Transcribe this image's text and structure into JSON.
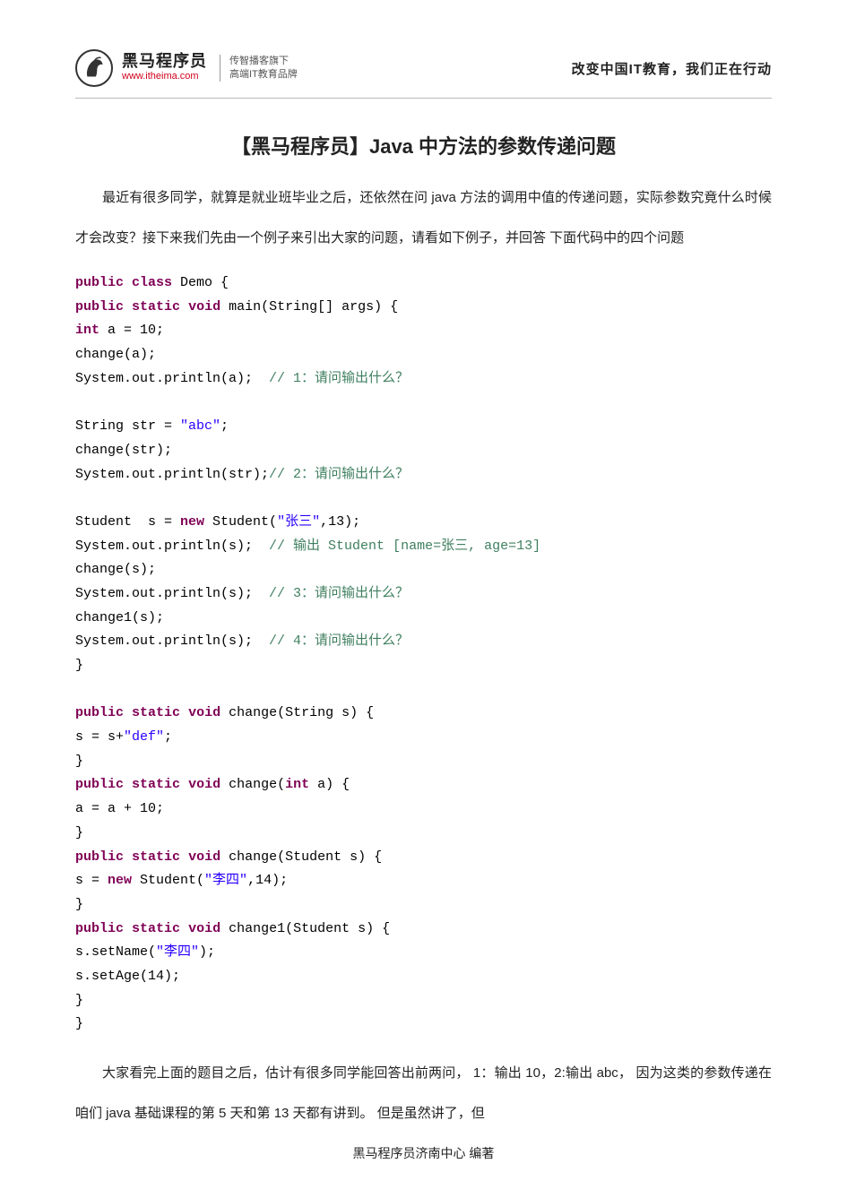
{
  "header": {
    "logo_cn": "黑马程序员",
    "logo_en": "www.itheima.com",
    "logo_side_line1": "传智播客旗下",
    "logo_side_line2": "高端IT教育品牌",
    "slogan": "改变中国IT教育，我们正在行动"
  },
  "title": "【黑马程序员】Java 中方法的参数传递问题",
  "intro": "最近有很多同学，就算是就业班毕业之后，还依然在问 java 方法的调用中值的传递问题，实际参数究竟什么时候才会改变？接下来我们先由一个例子来引出大家的问题，请看如下例子，并回答 下面代码中的四个问题",
  "code": {
    "l1a": "public",
    "l1b": "class",
    "l1c": " Demo {",
    "l2a": "public",
    "l2b": "static",
    "l2c": "void",
    "l2d": " main(String[] args) {",
    "l3a": "int",
    "l3b": " a = 10;",
    "l4": "change(a);",
    "l5a": "System.out.println(a);  ",
    "l5b": "// 1：请问输出什么？",
    "l6a": "String str = ",
    "l6b": "\"abc\"",
    "l6c": ";",
    "l7": "change(str);",
    "l8a": "System.out.println(str);",
    "l8b": "// 2：请问输出什么？",
    "l9a": "Student  s = ",
    "l9b": "new",
    "l9c": " Student(",
    "l9d": "\"张三\"",
    "l9e": ",13);",
    "l10a": "System.out.println(s);  ",
    "l10b": "// 输出 Student [name=张三, age=13]",
    "l11": "change(s);",
    "l12a": "System.out.println(s);  ",
    "l12b": "// 3：请问输出什么？",
    "l13": "change1(s);",
    "l14a": "System.out.println(s);  ",
    "l14b": "// 4：请问输出什么？",
    "l15": "}",
    "l16a": "public",
    "l16b": "static",
    "l16c": "void",
    "l16d": " change(String s) {",
    "l17a": "s = s+",
    "l17b": "\"def\"",
    "l17c": ";",
    "l18": "}",
    "l19a": "public",
    "l19b": "static",
    "l19c": "void",
    "l19d": " change(",
    "l19e": "int",
    "l19f": " a) {",
    "l20": "a = a + 10;",
    "l21": "}",
    "l22a": "public",
    "l22b": "static",
    "l22c": "void",
    "l22d": " change(Student s) {",
    "l23a": "s = ",
    "l23b": "new",
    "l23c": " Student(",
    "l23d": "\"李四\"",
    "l23e": ",14);",
    "l24": "}",
    "l25a": "public",
    "l25b": "static",
    "l25c": "void",
    "l25d": " change1(Student s) {",
    "l26a": "s.setName(",
    "l26b": "\"李四\"",
    "l26c": ");",
    "l27": "s.setAge(14);",
    "l28": "}",
    "l29": "}"
  },
  "outro": "大家看完上面的题目之后，估计有很多同学能回答出前两问， 1：输出 10，2:输出 abc， 因为这类的参数传递在咱们 java 基础课程的第 5 天和第 13 天都有讲到。 但是虽然讲了，但",
  "footer": "黑马程序员济南中心 编著"
}
